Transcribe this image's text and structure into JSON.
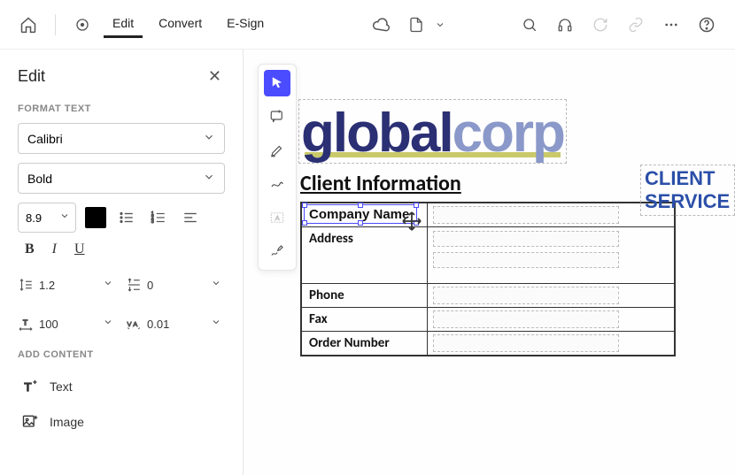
{
  "toolbar": {
    "tabs": {
      "edit": "Edit",
      "convert": "Convert",
      "esign": "E-Sign"
    }
  },
  "sidebar": {
    "title": "Edit",
    "section_format": "FORMAT TEXT",
    "font_family": "Calibri",
    "font_weight": "Bold",
    "font_size": "8.9",
    "line_height": "1.2",
    "paragraph_spacing": "0",
    "horizontal_scale": "100",
    "char_spacing": "0.01",
    "section_add": "ADD CONTENT",
    "add_text": "Text",
    "add_image": "Image"
  },
  "document": {
    "logo_a": "global",
    "logo_b": "corp",
    "banner": "CLIENT SERVICE",
    "heading": "Client Information",
    "rows": {
      "company": "Company Name",
      "address": "Address",
      "phone": "Phone",
      "fax": "Fax",
      "order": "Order Number"
    }
  }
}
